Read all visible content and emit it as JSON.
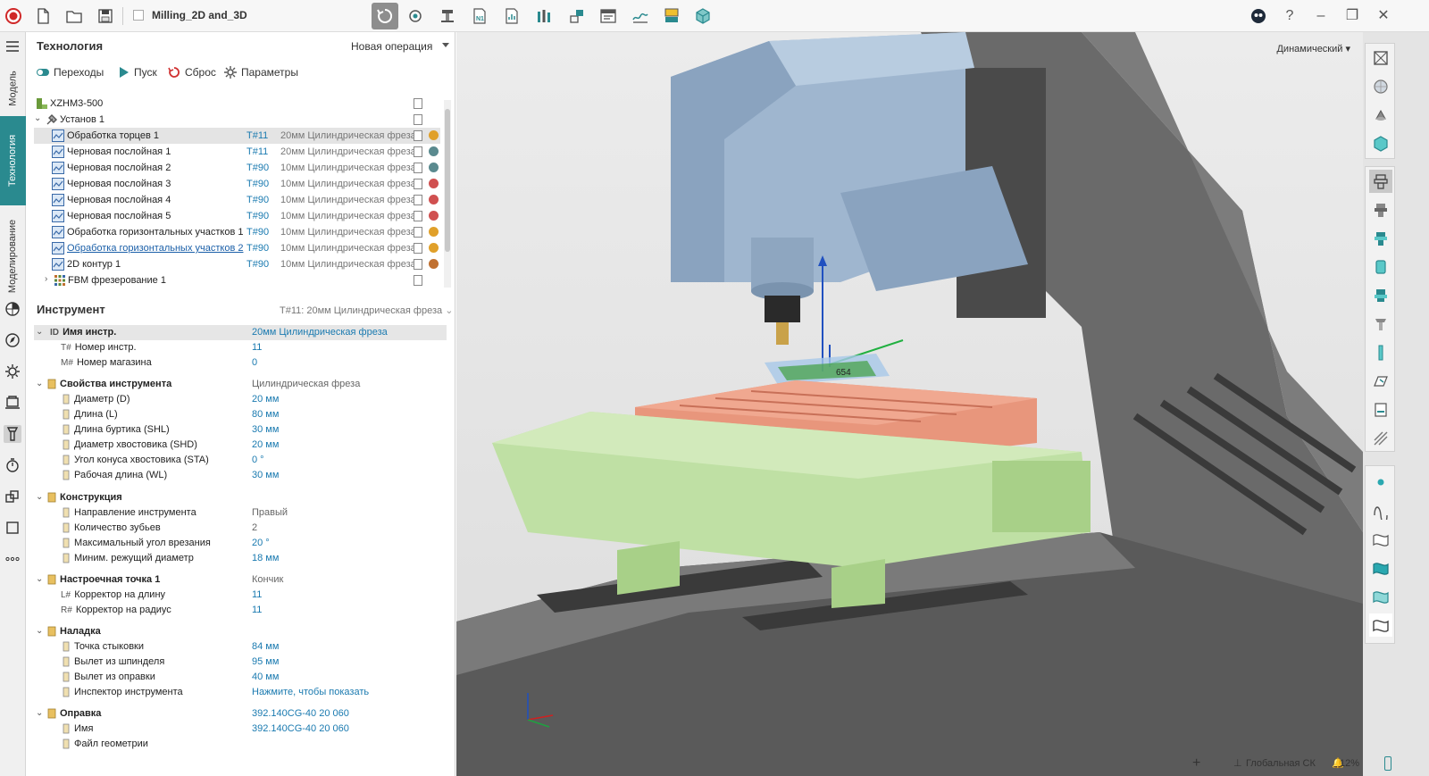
{
  "app": {
    "document_title": "Milling_2D and_3D",
    "window_controls": [
      "?",
      "–",
      "❐",
      "✕"
    ]
  },
  "toolbar": {
    "icons": [
      "app-logo-icon",
      "new-file-icon",
      "open-folder-icon",
      "save-icon",
      "tool-path-icon",
      "simulation-icon",
      "machine-icon",
      "nc-program-icon",
      "report-icon",
      "tool-library-icon",
      "setup-icon",
      "postprocessor-icon",
      "analysis-icon",
      "machine-panel-icon",
      "cube-view-icon"
    ],
    "accent_color": "#2a8a8f"
  },
  "left_tabs": {
    "model": "Модель",
    "technology": "Технология",
    "modeling": "Моделирование"
  },
  "panel": {
    "title": "Технология",
    "new_operation": "Новая операция",
    "actions": {
      "transitions": "Переходы",
      "start": "Пуск",
      "reset": "Сброс",
      "parameters": "Параметры"
    }
  },
  "tree": {
    "machine": "XZHM3-500",
    "setup": "Установ 1",
    "operations": [
      {
        "name": "Обработка торцев 1",
        "tool": "T#11",
        "desc": "20мм Цилиндрическая фреза",
        "status": "#e0a02a",
        "selected": true
      },
      {
        "name": "Черновая послойная 1",
        "tool": "T#11",
        "desc": "20мм Цилиндрическая фреза",
        "status": "#5a8a8f"
      },
      {
        "name": "Черновая послойная 2",
        "tool": "T#90",
        "desc": "10мм Цилиндрическая фреза",
        "status": "#5a8a8f"
      },
      {
        "name": "Черновая послойная 3",
        "tool": "T#90",
        "desc": "10мм Цилиндрическая фреза",
        "status": "#d05050"
      },
      {
        "name": "Черновая послойная 4",
        "tool": "T#90",
        "desc": "10мм Цилиндрическая фреза",
        "status": "#d05050"
      },
      {
        "name": "Черновая послойная 5",
        "tool": "T#90",
        "desc": "10мм Цилиндрическая фреза",
        "status": "#d05050"
      },
      {
        "name": "Обработка горизонтальных участков 1",
        "tool": "T#90",
        "desc": "10мм Цилиндрическая фреза",
        "status": "#e0a02a"
      },
      {
        "name": "Обработка горизонтальных участков 2",
        "tool": "T#90",
        "desc": "10мм Цилиндрическая фреза",
        "status": "#e0a02a",
        "link": true
      },
      {
        "name": "2D контур 1",
        "tool": "T#90",
        "desc": "10мм Цилиндрическая фреза",
        "status": "#c07030"
      }
    ],
    "fbm": "FBM фрезерование 1"
  },
  "tool_section": {
    "title": "Инструмент",
    "selected": "T#11: 20мм Цилиндрическая фреза",
    "rows": [
      {
        "label": "Имя инстр.",
        "prefix": "ID",
        "value": "20мм Цилиндрическая фреза",
        "group": true,
        "expanded": true
      },
      {
        "label": "Номер инстр.",
        "prefix": "T#",
        "value": "11"
      },
      {
        "label": "Номер магазина",
        "prefix": "M#",
        "value": "0"
      },
      {
        "label": "Свойства инструмента",
        "value": "Цилиндрическая фреза",
        "group": true,
        "gray": true
      },
      {
        "label": "Диаметр (D)",
        "value": "20 мм"
      },
      {
        "label": "Длина (L)",
        "value": "80 мм"
      },
      {
        "label": "Длина буртика (SHL)",
        "value": "30 мм"
      },
      {
        "label": "Диаметр хвостовика (SHD)",
        "value": "20 мм"
      },
      {
        "label": "Угол конуса хвостовика (STA)",
        "value": "0 °"
      },
      {
        "label": "Рабочая длина (WL)",
        "value": "30 мм"
      },
      {
        "label": "Конструкция",
        "value": "",
        "group": true
      },
      {
        "label": "Направление инструмента",
        "value": "Правый",
        "gray": true
      },
      {
        "label": "Количество зубьев",
        "value": "2",
        "gray": true
      },
      {
        "label": "Максимальный угол врезания",
        "value": "20 °"
      },
      {
        "label": "Миним. режущий диаметр",
        "value": "18 мм"
      },
      {
        "label": "Настроечная точка 1",
        "value": "Кончик",
        "group": true,
        "gray": true
      },
      {
        "label": "Корректор на длину",
        "prefix": "L#",
        "value": "11"
      },
      {
        "label": "Корректор на радиус",
        "prefix": "R#",
        "value": "11"
      },
      {
        "label": "Наладка",
        "value": "",
        "group": true
      },
      {
        "label": "Точка стыковки",
        "value": "84 мм"
      },
      {
        "label": "Вылет из шпинделя",
        "value": "95 мм"
      },
      {
        "label": "Вылет из оправки",
        "value": "40 мм"
      },
      {
        "label": "Инспектор инструмента",
        "value": "Нажмите, чтобы показать"
      },
      {
        "label": "Оправка",
        "value": "392.140CG-40 20 060",
        "group": true
      },
      {
        "label": "Имя",
        "value": "392.140CG-40 20 060"
      },
      {
        "label": "Файл геометрии",
        "value": ""
      }
    ]
  },
  "viewport": {
    "mode": "Динамический",
    "dimension_label": "654",
    "status_cs": "Глобальная СК",
    "zoom": "12%"
  }
}
